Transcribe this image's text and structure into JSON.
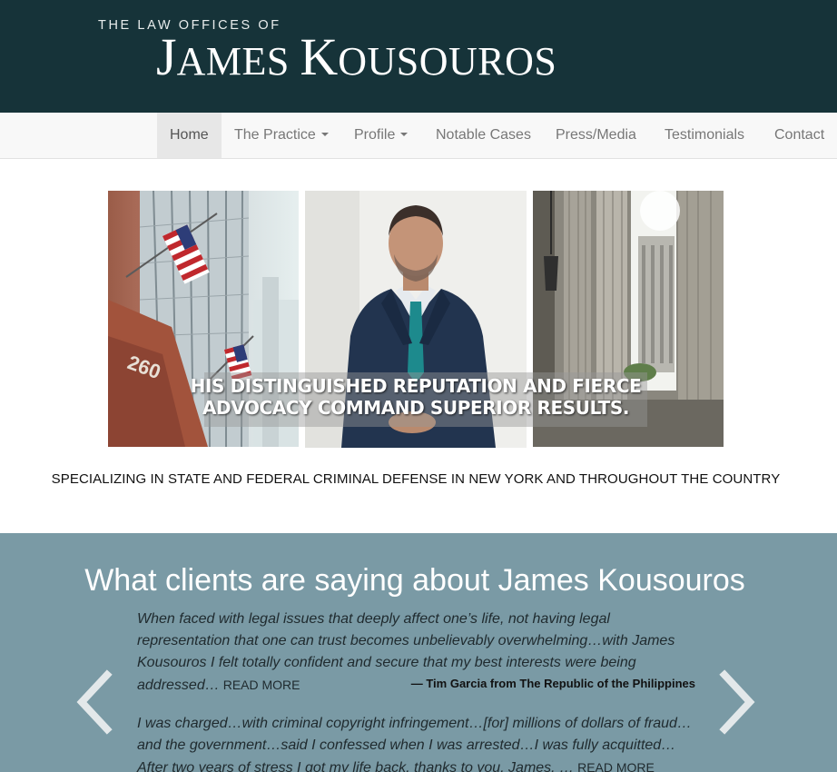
{
  "header": {
    "logo_top": "THE LAW OFFICES OF",
    "logo_name_j": "J",
    "logo_name_ames": "AMES",
    "logo_name_k": "K",
    "logo_name_ousouros": "OUSOUROS",
    "background_color": "#163339"
  },
  "nav": {
    "items": [
      {
        "label": "Home",
        "active": true
      },
      {
        "label": "The Practice",
        "dropdown": true
      },
      {
        "label": "Profile",
        "dropdown": true
      },
      {
        "label": "Notable Cases"
      },
      {
        "label": "Press/Media"
      },
      {
        "label": "Testimonials"
      },
      {
        "label": "Contact"
      }
    ]
  },
  "hero": {
    "caption_line1": "HIS DISTINGUISHED REPUTATION AND FIERCE",
    "caption_line2": "ADVOCACY COMMAND SUPERIOR RESULTS.",
    "tagline": "SPECIALIZING IN STATE AND FEDERAL CRIMINAL DEFENSE IN NEW YORK AND THROUGHOUT THE COUNTRY"
  },
  "testimonials": {
    "heading": "What clients are saying about James Kousouros",
    "background_color": "#7a9aa5",
    "items": [
      {
        "text": "When faced with legal issues that deeply affect one’s life, not having legal representation that one can trust becomes unbelievably overwhelming…with James Kousouros I felt totally confident and secure that my best interests were being addressed…",
        "read_more": "READ MORE",
        "attribution": "— Tim Garcia from The Republic of the Philippines"
      },
      {
        "text": "I was charged…with criminal copyright infringement…[for] millions of dollars of fraud… and the government…said I confessed when I was arrested…I was fully acquitted… After two years of stress I got my life back, thanks to you, James. …",
        "read_more": "READ MORE"
      }
    ],
    "prev_icon": "chevron-left-icon",
    "next_icon": "chevron-right-icon"
  }
}
